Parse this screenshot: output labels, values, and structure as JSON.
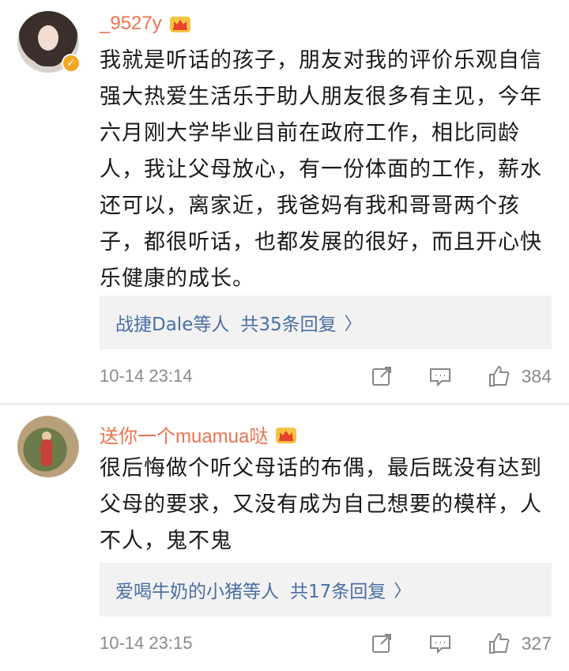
{
  "comments": [
    {
      "username": "_9527y",
      "badge_icon": "crown-icon",
      "verified": true,
      "text": "我就是听话的孩子，朋友对我的评价乐观自信强大热爱生活乐于助人朋友很多有主见，今年六月刚大学毕业目前在政府工作，相比同龄人，我让父母放心，有一份体面的工作，薪水还可以，离家近，我爸妈有我和哥哥两个孩子，都很听话，也都发展的很好，而且开心快乐健康的成长。",
      "replies": {
        "names": "战捷Dale等人",
        "count": "共35条回复"
      },
      "time": "10-14 23:14",
      "likes": "384"
    },
    {
      "username": "送你一个muamua哒",
      "badge_icon": "crown-icon",
      "verified": false,
      "text": "很后悔做个听父母话的布偶，最后既没有达到父母的要求，又没有成为自己想要的模样，人不人，鬼不鬼",
      "replies": {
        "names": "爱喝牛奶的小猪等人",
        "count": "共17条回复"
      },
      "time": "10-14 23:15",
      "likes": "327"
    }
  ],
  "colors": {
    "username": "#eb7350",
    "link": "#4b6fa3",
    "meta": "#8a8a8a",
    "reply_bg": "#f2f2f2"
  }
}
